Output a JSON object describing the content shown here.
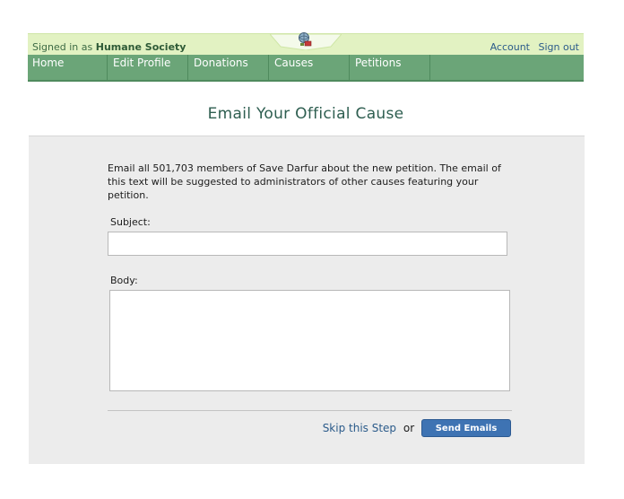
{
  "header": {
    "signed_in_prefix": "Signed in as",
    "signed_in_name": "Humane Society",
    "account_link": "Account",
    "signout_link": "Sign out",
    "logo_icon": "globe-logo-icon"
  },
  "nav": {
    "items": [
      {
        "label": "Home"
      },
      {
        "label": "Edit Profile"
      },
      {
        "label": "Donations"
      },
      {
        "label": "Causes"
      },
      {
        "label": "Petitions"
      }
    ]
  },
  "main": {
    "title": "Email Your Official Cause",
    "intro": "Email all 501,703 members of Save Darfur about the new petition. The email of this text will be suggested to administrators of other causes featuring your petition.",
    "subject_label": "Subject:",
    "subject_value": "",
    "body_label": "Body:",
    "body_value": "",
    "skip_link": "Skip this Step",
    "or_text": "or",
    "send_button": "Send Emails"
  },
  "colors": {
    "topbar_bg": "#e2f2c2",
    "nav_bg": "#6ba578",
    "title_color": "#2e5e50",
    "panel_bg": "#ececec",
    "link_color": "#2b5b8a",
    "button_bg": "#3e73b3"
  }
}
